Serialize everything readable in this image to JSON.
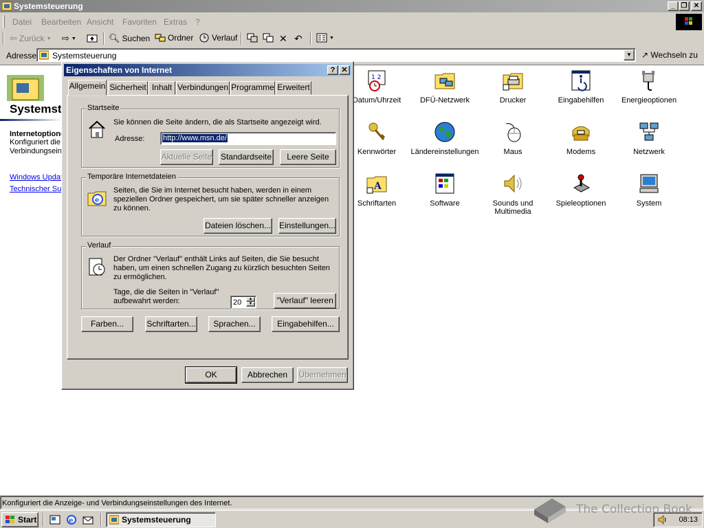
{
  "window": {
    "title": "Systemsteuerung"
  },
  "menu": [
    "Datei",
    "Bearbeiten",
    "Ansicht",
    "Favoriten",
    "Extras",
    "?"
  ],
  "toolbar": {
    "back": "Zurück",
    "search": "Suchen",
    "folders": "Ordner",
    "history": "Verlauf"
  },
  "addressbar": {
    "label": "Adresse",
    "value": "Systemsteuerung",
    "go": "Wechseln zu"
  },
  "leftpane": {
    "title": "Systemsteuerung",
    "heading": "Internetoptionen",
    "description": "Konfiguriert die Anzeige- und Verbindungseinstellungen des Internet.",
    "links": [
      "Windows Update",
      "Technischer Support"
    ]
  },
  "items": [
    {
      "label": "Datum/Uhrzeit",
      "icon": "clock-calendar-icon"
    },
    {
      "label": "DFÜ-Netzwerk",
      "icon": "network-folder-icon"
    },
    {
      "label": "Drucker",
      "icon": "printer-folder-icon"
    },
    {
      "label": "Eingabehilfen",
      "icon": "accessibility-icon"
    },
    {
      "label": "Energieoptionen",
      "icon": "power-plug-icon"
    },
    {
      "label": "Kennwörter",
      "icon": "keys-icon"
    },
    {
      "label": "Ländereinstellungen",
      "icon": "globe-icon"
    },
    {
      "label": "Maus",
      "icon": "mouse-icon"
    },
    {
      "label": "Modems",
      "icon": "modem-icon"
    },
    {
      "label": "Netzwerk",
      "icon": "network-icon"
    },
    {
      "label": "Schriftarten",
      "icon": "fonts-folder-icon"
    },
    {
      "label": "Software",
      "icon": "software-icon"
    },
    {
      "label": "Sounds und Multimedia",
      "icon": "speaker-icon"
    },
    {
      "label": "Spieleoptionen",
      "icon": "joystick-icon"
    },
    {
      "label": "System",
      "icon": "computer-icon"
    }
  ],
  "status": "Konfiguriert die Anzeige- und Verbindungseinstellungen des Internet.",
  "taskbar": {
    "start": "Start",
    "task": "Systemsteuerung",
    "clock": "08:13"
  },
  "watermark": "The Collection Book",
  "dialog": {
    "title": "Eigenschaften von Internet",
    "tabs": [
      "Allgemein",
      "Sicherheit",
      "Inhalt",
      "Verbindungen",
      "Programme",
      "Erweitert"
    ],
    "startseite": {
      "label": "Startseite",
      "text": "Sie können die Seite ändern, die als Startseite angezeigt wird.",
      "address_label": "Adresse:",
      "address_value": "http://www.msn.de/",
      "btn_current": "Aktuelle Seite",
      "btn_default": "Standardseite",
      "btn_blank": "Leere Seite"
    },
    "temp": {
      "label": "Temporäre Internetdateien",
      "text": "Seiten, die Sie im Internet besucht haben, werden in einem speziellen Ordner gespeichert, um sie später schneller anzeigen zu können.",
      "btn_delete": "Dateien löschen...",
      "btn_settings": "Einstellungen..."
    },
    "history": {
      "label": "Verlauf",
      "text": "Der Ordner \"Verlauf\" enthält Links auf Seiten, die Sie besucht haben, um einen schnellen Zugang zu kürzlich besuchten Seiten zu ermöglichen.",
      "days_label": "Tage, die die Seiten in \"Verlauf\" aufbewahrt werden:",
      "days_value": "20",
      "btn_clear": "\"Verlauf\" leeren"
    },
    "bottom_buttons": [
      "Farben...",
      "Schriftarten...",
      "Sprachen...",
      "Eingabehilfen..."
    ],
    "ok": "OK",
    "cancel": "Abbrechen",
    "apply": "Übernehmen"
  }
}
